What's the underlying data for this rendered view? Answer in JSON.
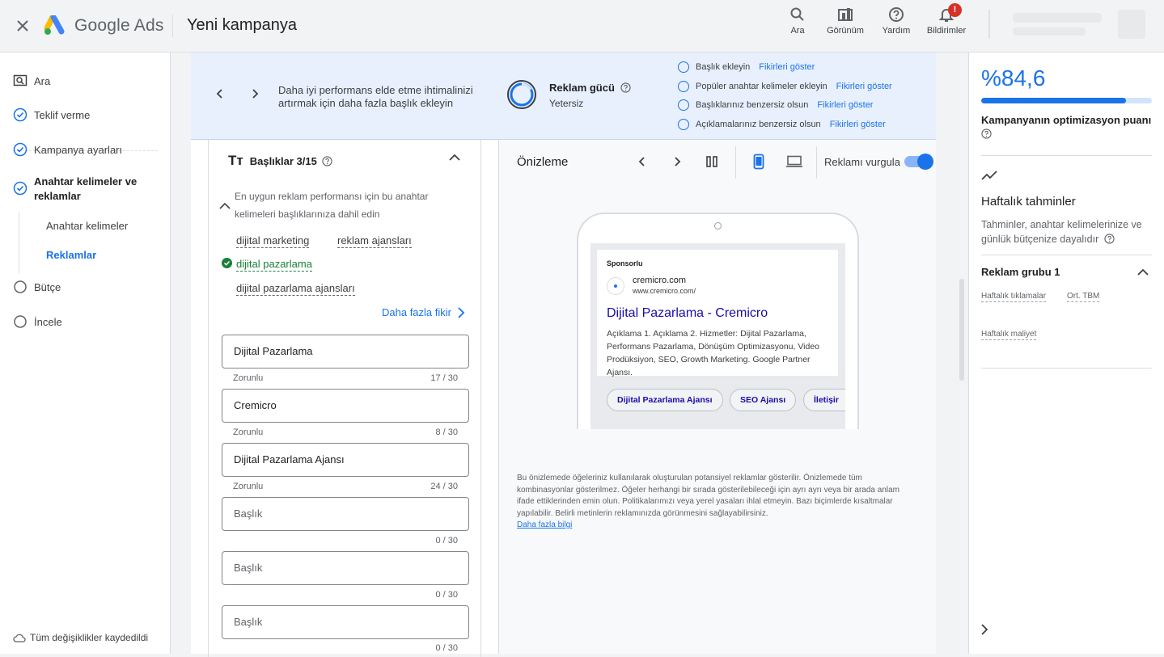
{
  "app": {
    "brand": "Google Ads",
    "title": "Yeni kampanya"
  },
  "toolbar": {
    "search_label": "Ara",
    "appearance_label": "Görünüm",
    "help_label": "Yardım",
    "notifications_label": "Bildirimler",
    "notification_badge": "!"
  },
  "sidebar": {
    "items": [
      {
        "label": "Ara"
      },
      {
        "label": "Teklif verme"
      },
      {
        "label": "Kampanya ayarları"
      },
      {
        "label": "Anahtar kelimeler ve reklamlar"
      },
      {
        "label": "Anahtar kelimeler"
      },
      {
        "label": "Reklamlar"
      },
      {
        "label": "Bütçe"
      },
      {
        "label": "İncele"
      }
    ],
    "saved_status": "Tüm değişiklikler kaydedildi"
  },
  "banner": {
    "message": "Daha iyi performans elde etme ihtimalinizi artırmak için daha fazla başlık ekleyin",
    "strength_label": "Reklam gücü",
    "strength_value": "Yetersiz",
    "tips": [
      {
        "text": "Başlık ekleyin",
        "link": "Fikirleri göster"
      },
      {
        "text": "Popüler anahtar kelimeler ekleyin",
        "link": "Fikirleri göster"
      },
      {
        "text": "Başlıklarınız benzersiz olsun",
        "link": "Fikirleri göster"
      },
      {
        "text": "Açıklamalarınız benzersiz olsun",
        "link": "Fikirleri göster"
      }
    ]
  },
  "headlines": {
    "title": "Başlıklar 3/15",
    "title_icon": "Tт",
    "keyword_hint": "En uygun reklam performansı için bu anahtar kelimeleri başlıklarınıza dahil edin",
    "keywords": [
      "dijital marketing",
      "reklam ajansları",
      "dijital pazarlama",
      "dijital pazarlama ajansları"
    ],
    "more_ideas": "Daha fazla fikir",
    "fields": [
      {
        "value": "Dijital Pazarlama",
        "helper": "Zorunlu",
        "count": "17 / 30"
      },
      {
        "value": "Cremicro",
        "helper": "Zorunlu",
        "count": "8 / 30"
      },
      {
        "value": "Dijital Pazarlama Ajansı",
        "helper": "Zorunlu",
        "count": "24 / 30"
      },
      {
        "value": "",
        "placeholder": "Başlık",
        "helper": "",
        "count": "0 / 30"
      },
      {
        "value": "",
        "placeholder": "Başlık",
        "helper": "",
        "count": "0 / 30"
      },
      {
        "value": "",
        "placeholder": "Başlık",
        "helper": "",
        "count": "0 / 30"
      }
    ]
  },
  "preview": {
    "title": "Önizleme",
    "highlight_label": "Reklamı vurgula",
    "highlight_on": true,
    "ad": {
      "sponsored": "Sponsorlu",
      "site_name": "cremicro.com",
      "url": "www.cremicro.com/",
      "headline": "Dijital Pazarlama - Cremicro",
      "description": "Açıklama 1. Açıklama 2. Hizmetler: Dijital Pazarlama, Performans Pazarlama, Dönüşüm Optimizasyonu, Video Prodüksiyon, SEO, Growth Marketing. Google Partner Ajansı.",
      "sitelinks": [
        "Dijital Pazarlama Ajansı",
        "SEO Ajansı",
        "İletişir"
      ]
    },
    "disclaimer": "Bu önizlemede öğeleriniz kullanılarak oluşturulan potansiyel reklamlar gösterilir. Önizlemede tüm kombinasyonlar gösterilmez. Öğeler herhangi bir sırada gösterilebileceği için ayrı ayrı veya bir arada anlam ifade ettiklerinden emin olun. Politikalarımızı veya yerel yasaları ihlal etmeyin. Bazı biçimlerde kısaltmalar yapılabilir. Belirli metinlerin reklamınızda görünmesini sağlayabilirsiniz.",
    "learn_more": "Daha fazla bilgi"
  },
  "optimization": {
    "score_text": "%84,6",
    "score_value": 0.846,
    "label": "Kampanyanın optimizasyon puanı"
  },
  "forecast": {
    "title": "Haftalık tahminler",
    "subtitle": "Tahminler, anahtar kelimelerinize ve günlük bütçenize dayalıdır",
    "group_title": "Reklam grubu 1",
    "weekly_clicks": "Haftalık tıklamalar",
    "avg_cpc": "Ort. TBM",
    "weekly_cost": "Haftalık maliyet"
  },
  "colors": {
    "accent": "#1a73e8",
    "success": "#188038",
    "banner_bg": "#e8f0fe",
    "ad_link": "#1a0dab"
  }
}
